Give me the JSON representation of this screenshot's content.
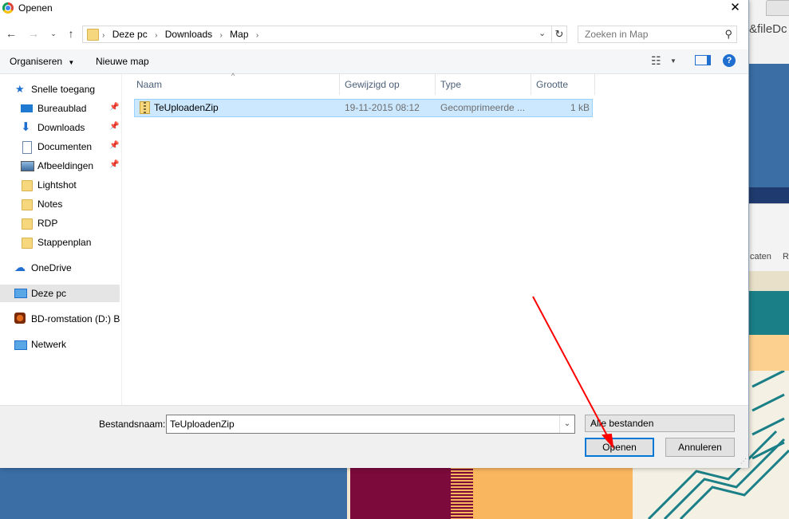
{
  "background": {
    "url_fragment": "&fileDc",
    "toolbar_text_1": "caten",
    "toolbar_text_2": "R"
  },
  "dialog": {
    "title": "Openen",
    "close_symbol": "✕",
    "address": {
      "crumbs": [
        "Deze pc",
        "Downloads",
        "Map"
      ],
      "separator": "›"
    },
    "search": {
      "placeholder": "Zoeken in Map"
    },
    "commands": {
      "organize": "Organiseren",
      "new_folder": "Nieuwe map"
    },
    "help_label": "?",
    "nav": {
      "quick_access": "Snelle toegang",
      "items": [
        {
          "label": "Bureaublad",
          "icon": "desktop-icon",
          "pinned": true
        },
        {
          "label": "Downloads",
          "icon": "download-icon",
          "pinned": true
        },
        {
          "label": "Documenten",
          "icon": "document-icon",
          "pinned": true
        },
        {
          "label": "Afbeeldingen",
          "icon": "pictures-icon",
          "pinned": true
        },
        {
          "label": "Lightshot",
          "icon": "folder-icon",
          "pinned": false
        },
        {
          "label": "Notes",
          "icon": "folder-icon",
          "pinned": false
        },
        {
          "label": "RDP",
          "icon": "folder-icon",
          "pinned": false
        },
        {
          "label": "Stappenplan",
          "icon": "folder-icon",
          "pinned": false
        }
      ],
      "onedrive": "OneDrive",
      "this_pc": "Deze pc",
      "bd_rom": "BD-romstation (D:) B",
      "network": "Netwerk"
    },
    "columns": {
      "name": "Naam",
      "modified": "Gewijzigd op",
      "type": "Type",
      "size": "Grootte"
    },
    "files": [
      {
        "name": "TeUploadenZip",
        "modified": "19-11-2015 08:12",
        "type": "Gecomprimeerde ...",
        "size": "1 kB",
        "selected": true
      }
    ],
    "footer": {
      "filename_label": "Bestandsnaam:",
      "filename_value": "TeUploadenZip",
      "file_type": "Alle bestanden",
      "open_button": "Openen",
      "cancel_button": "Annuleren"
    }
  },
  "colors": {
    "accent": "#0078d7",
    "selection_bg": "#cce8ff",
    "annotation_arrow": "#ff0000",
    "bg_blue": "#3a6ea5"
  }
}
